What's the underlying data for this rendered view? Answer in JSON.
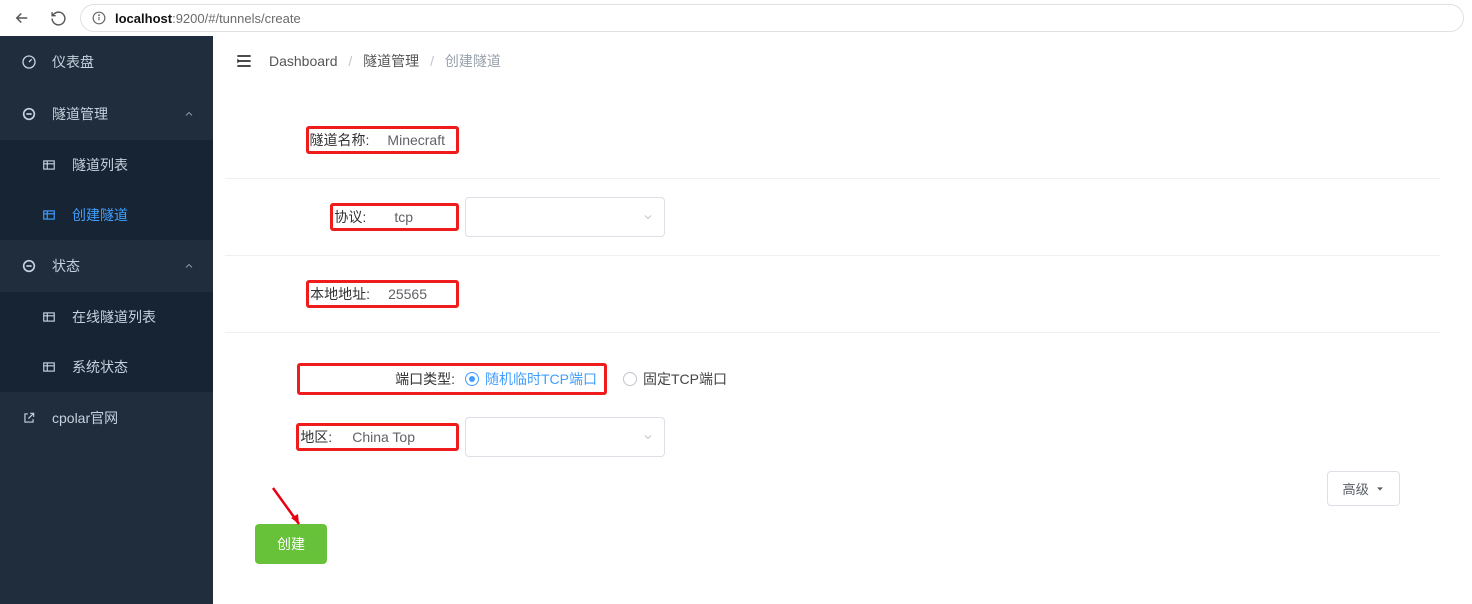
{
  "browser": {
    "host_bold": "localhost",
    "host_rest": ":9200/#/tunnels/create"
  },
  "sidebar": {
    "dashboard": "仪表盘",
    "tunnel_mgmt": "隧道管理",
    "tunnel_list": "隧道列表",
    "tunnel_create": "创建隧道",
    "status": "状态",
    "online_list": "在线隧道列表",
    "system_status": "系统状态",
    "cpolar_site": "cpolar官网"
  },
  "breadcrumb": {
    "a": "Dashboard",
    "b": "隧道管理",
    "c": "创建隧道",
    "sep": "/"
  },
  "form": {
    "name_label": "隧道名称:",
    "name_value": "Minecraft",
    "proto_label": "协议:",
    "proto_value": "tcp",
    "addr_label": "本地地址:",
    "addr_value": "25565",
    "port_type_label": "端口类型:",
    "port_random": "随机临时TCP端口",
    "port_fixed": "固定TCP端口",
    "region_label": "地区:",
    "region_value": "China Top",
    "advanced": "高级",
    "create_btn": "创建"
  }
}
